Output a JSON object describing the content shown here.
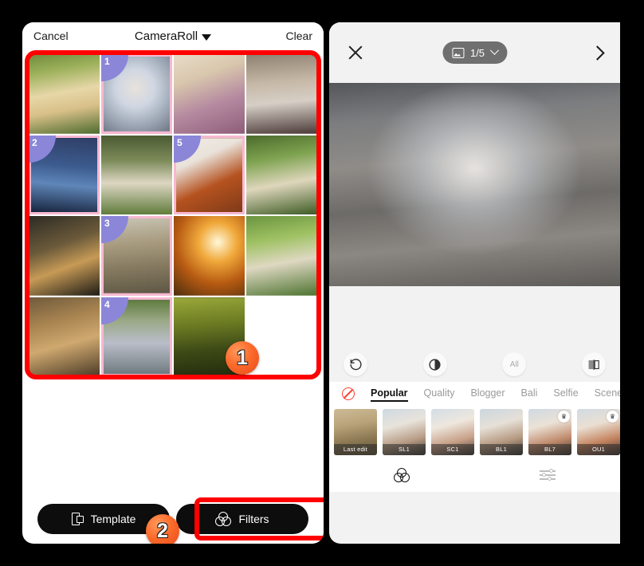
{
  "left_panel": {
    "topbar": {
      "cancel_label": "Cancel",
      "title": "CameraRoll",
      "clear_label": "Clear"
    },
    "grid": {
      "columns": 4,
      "rows": 4,
      "items": [
        {
          "alt": "golden retriever puppy in garden",
          "selected": false,
          "badge": ""
        },
        {
          "alt": "dog wearing koala costume",
          "selected": true,
          "badge": "1"
        },
        {
          "alt": "three border collie puppies",
          "selected": false,
          "badge": ""
        },
        {
          "alt": "kittens in a basket",
          "selected": false,
          "badge": ""
        },
        {
          "alt": "blue lake with birds at dusk",
          "selected": true,
          "badge": "2"
        },
        {
          "alt": "white rabbit on grass",
          "selected": false,
          "badge": ""
        },
        {
          "alt": "red panda close-up",
          "selected": true,
          "badge": "5"
        },
        {
          "alt": "guinea pig in grass",
          "selected": false,
          "badge": ""
        },
        {
          "alt": "monkey sitting on rock",
          "selected": false,
          "badge": ""
        },
        {
          "alt": "tabby cat lying down",
          "selected": true,
          "badge": "3"
        },
        {
          "alt": "autumn sunset through leaves",
          "selected": false,
          "badge": ""
        },
        {
          "alt": "guinea pig with daisies",
          "selected": false,
          "badge": ""
        },
        {
          "alt": "dog in autumn leaves",
          "selected": false,
          "badge": ""
        },
        {
          "alt": "white rabbit on rocks",
          "selected": true,
          "badge": "4"
        },
        {
          "alt": "stag deer in forest",
          "selected": false,
          "badge": ""
        },
        {
          "alt": "",
          "selected": false,
          "badge": "",
          "empty": true
        }
      ]
    },
    "bottom_actions": {
      "template_label": "Template",
      "filters_label": "Filters"
    }
  },
  "annotations": [
    {
      "number": "1",
      "target": "photo-grid"
    },
    {
      "number": "2",
      "target": "filters-button"
    }
  ],
  "right_panel": {
    "header": {
      "close_icon": "close-icon",
      "counter": "1/5",
      "image_icon": "image-icon",
      "chevron_down_icon": "chevron-down-icon",
      "next_icon": "chevron-right-icon"
    },
    "preview": {
      "alt": "dog wearing koala costume on wooden deck"
    },
    "tools": [
      {
        "name": "reset",
        "icon": "undo-icon"
      },
      {
        "name": "contrast",
        "icon": "contrast-icon"
      },
      {
        "name": "all",
        "label": "All"
      },
      {
        "name": "compare",
        "icon": "compare-icon"
      }
    ],
    "categories": [
      {
        "label": "Popular",
        "active": true
      },
      {
        "label": "Quality",
        "active": false
      },
      {
        "label": "Blogger",
        "active": false
      },
      {
        "label": "Bali",
        "active": false
      },
      {
        "label": "Selfie",
        "active": false
      },
      {
        "label": "Scenery",
        "active": false
      }
    ],
    "no_filter_icon": "no-filter-icon",
    "filter_thumbs": [
      {
        "label": "Last edit",
        "premium": false
      },
      {
        "label": "SL1",
        "premium": false
      },
      {
        "label": "SC1",
        "premium": false
      },
      {
        "label": "BL1",
        "premium": false
      },
      {
        "label": "BL7",
        "premium": true
      },
      {
        "label": "OU1",
        "premium": true
      },
      {
        "label": "",
        "premium": false
      }
    ],
    "bottom_nav": [
      {
        "name": "filters",
        "icon": "circles-icon",
        "active": true
      },
      {
        "name": "adjust",
        "icon": "sliders-icon",
        "active": false
      }
    ]
  },
  "colors": {
    "annotation_red": "#ff0000",
    "annotation_orange": "#fb6a2b",
    "badge_purple": "#8b86d8",
    "selected_border": "#f7b8d0",
    "panel_bg": "#f2f2f2"
  }
}
